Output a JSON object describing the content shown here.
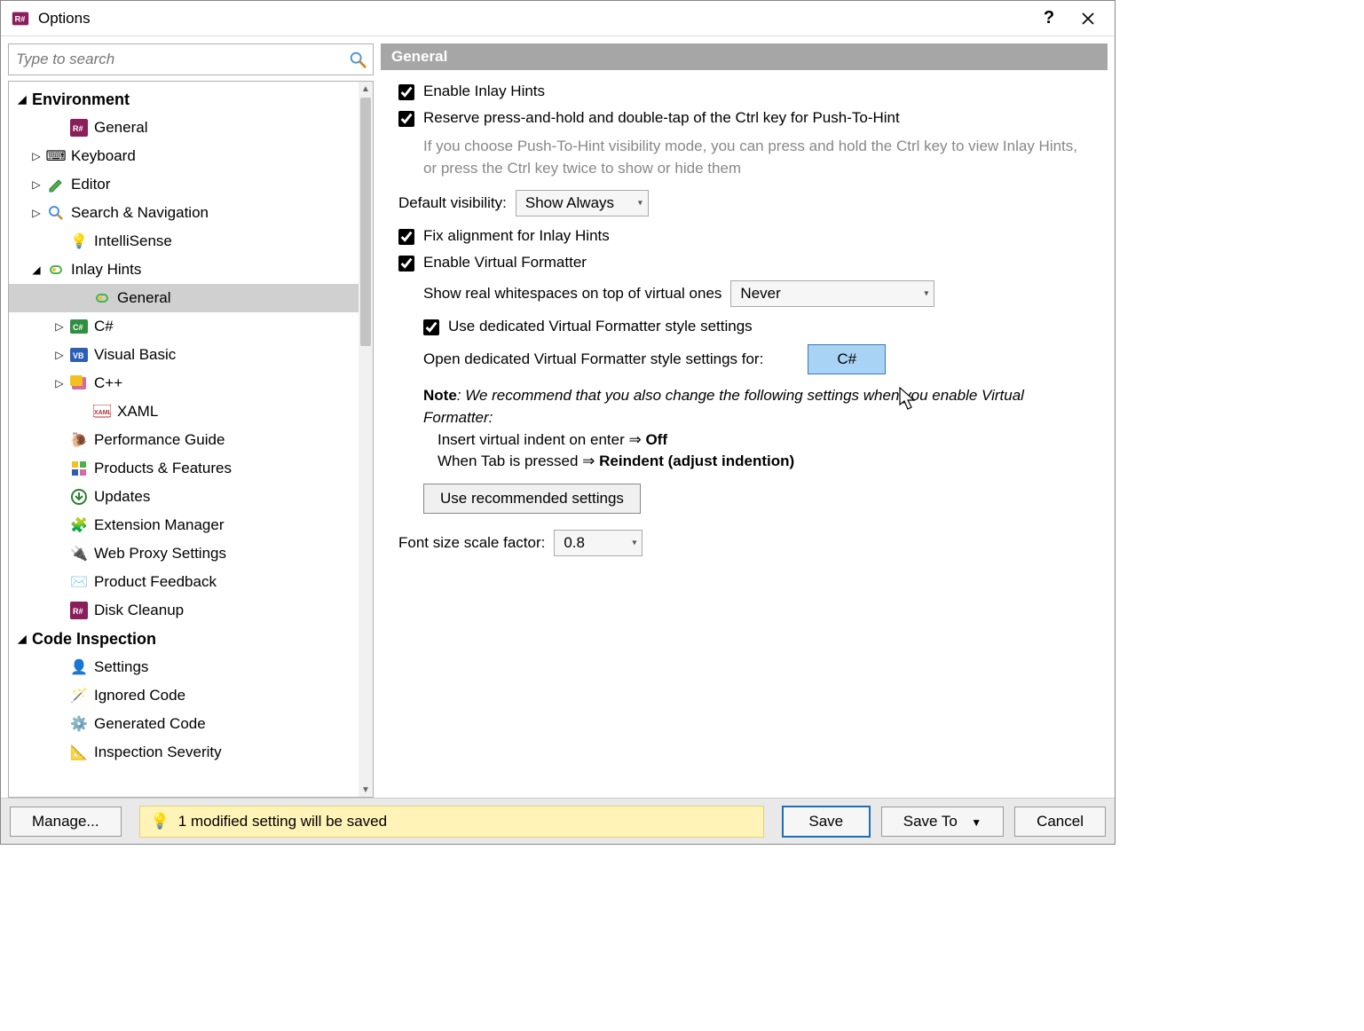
{
  "window": {
    "title": "Options"
  },
  "search": {
    "placeholder": "Type to search"
  },
  "tree": {
    "cat_environment": "Environment",
    "env_general": "General",
    "env_keyboard": "Keyboard",
    "env_editor": "Editor",
    "env_search": "Search & Navigation",
    "env_intelli": "IntelliSense",
    "env_inlay": "Inlay Hints",
    "inlay_general": "General",
    "inlay_csharp": "C#",
    "inlay_vb": "Visual Basic",
    "inlay_cpp": "C++",
    "inlay_xaml": "XAML",
    "env_perf": "Performance Guide",
    "env_products": "Products & Features",
    "env_updates": "Updates",
    "env_ext": "Extension Manager",
    "env_proxy": "Web Proxy Settings",
    "env_feedback": "Product Feedback",
    "env_disk": "Disk Cleanup",
    "cat_codeinsp": "Code Inspection",
    "ci_settings": "Settings",
    "ci_ignored": "Ignored Code",
    "ci_generated": "Generated Code",
    "ci_severity": "Inspection Severity"
  },
  "panel": {
    "header": "General",
    "enable_inlay": "Enable Inlay Hints",
    "reserve_ctrl": "Reserve press-and-hold and double-tap of the Ctrl key for Push-To-Hint",
    "reserve_hint": "If you choose Push-To-Hint visibility mode, you can press and hold the Ctrl key to view Inlay Hints, or press the Ctrl key twice to show or hide them",
    "default_visibility_label": "Default visibility:",
    "default_visibility_value": "Show Always",
    "fix_alignment": "Fix alignment for Inlay Hints",
    "enable_vf": "Enable Virtual Formatter",
    "show_real_ws_label": "Show real whitespaces on top of virtual ones",
    "show_real_ws_value": "Never",
    "use_dedicated_vf": "Use dedicated Virtual Formatter style settings",
    "open_dedicated_label": "Open dedicated Virtual Formatter style settings for:",
    "open_dedicated_btn": "C#",
    "note_label": "Note",
    "note_text": ": We recommend that you also change the following settings when you enable Virtual Formatter:",
    "rec1_a": "Insert virtual indent on enter ⇒ ",
    "rec1_b": "Off",
    "rec2_a": "When Tab is pressed ⇒ ",
    "rec2_b": "Reindent (adjust indention)",
    "use_recommended_btn": "Use recommended settings",
    "font_scale_label": "Font size scale factor:",
    "font_scale_value": "0.8"
  },
  "footer": {
    "manage": "Manage...",
    "status": "1 modified setting will be saved",
    "save": "Save",
    "save_to": "Save To",
    "cancel": "Cancel"
  }
}
